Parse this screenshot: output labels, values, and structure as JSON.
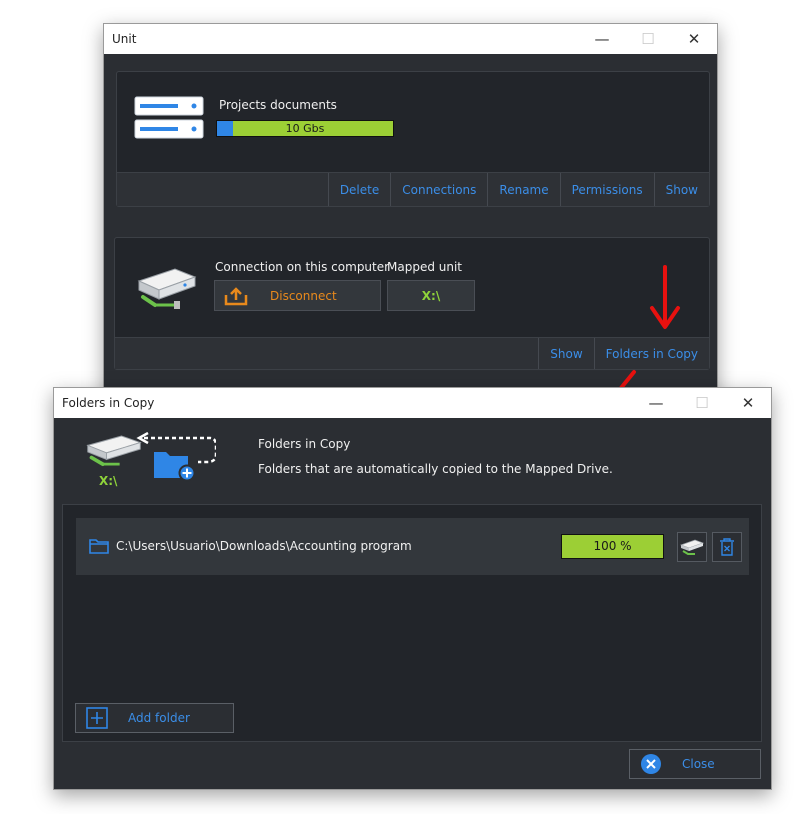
{
  "unit_window": {
    "title": "Unit",
    "storage": {
      "name": "Projects documents",
      "usage_label": "10 Gbs",
      "usage_fraction": 0.09,
      "actions": [
        "Delete",
        "Connections",
        "Rename",
        "Permissions",
        "Show"
      ]
    },
    "connection": {
      "label": "Connection on this computer",
      "disconnect_label": "Disconnect",
      "mapped_label": "Mapped unit",
      "mapped_value": "X:\\",
      "actions": [
        "Show",
        "Folders in Copy"
      ]
    }
  },
  "folders_window": {
    "title": "Folders in Copy",
    "drive_letter": "X:\\",
    "heading": "Folders in Copy",
    "description": "Folders that are automatically copied to the Mapped Drive.",
    "folders": [
      {
        "path": "C:\\Users\\Usuario\\Downloads\\Accounting program",
        "progress_label": "100 %",
        "progress": 1.0
      }
    ],
    "add_folder_label": "Add folder",
    "close_label": "Close"
  },
  "colors": {
    "accent": "#3b8ee8",
    "progress_green": "#9ccf35",
    "disconnect_orange": "#e8891c",
    "drive_green": "#8fd33a",
    "annotation_red": "#e8110f",
    "window_bg": "#2b2e33"
  },
  "icons": {
    "server": "server-icon",
    "network_drive": "network-drive-icon",
    "folder": "folder-icon",
    "upload": "upload-icon",
    "plus": "plus-icon",
    "close": "close-circle-icon",
    "delete": "delete-icon"
  }
}
